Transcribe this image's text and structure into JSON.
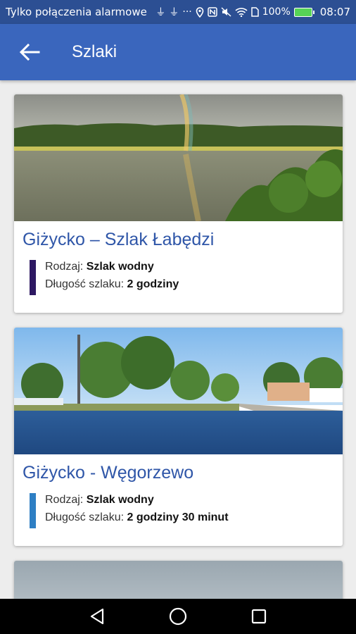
{
  "status_bar": {
    "carrier": "Tylko połączenia alarmowe",
    "battery": "100%",
    "time": "08:07"
  },
  "toolbar": {
    "title": "Szlaki"
  },
  "trails": [
    {
      "title": "Giżycko – Szlak Łabędzi",
      "type_label": "Rodzaj:",
      "type_value": "Szlak wodny",
      "length_label": "Długość szlaku:",
      "length_value": "2 godziny",
      "accent": "#2d1862"
    },
    {
      "title": "Giżycko - Węgorzewo",
      "type_label": "Rodzaj:",
      "type_value": "Szlak wodny",
      "length_label": "Długość szlaku:",
      "length_value": "2 godziny 30 minut",
      "accent": "#2e7fc4"
    }
  ],
  "colors": {
    "status_bar": "#2c4f93",
    "toolbar": "#3a66bd",
    "title_text": "#2f56a8"
  }
}
